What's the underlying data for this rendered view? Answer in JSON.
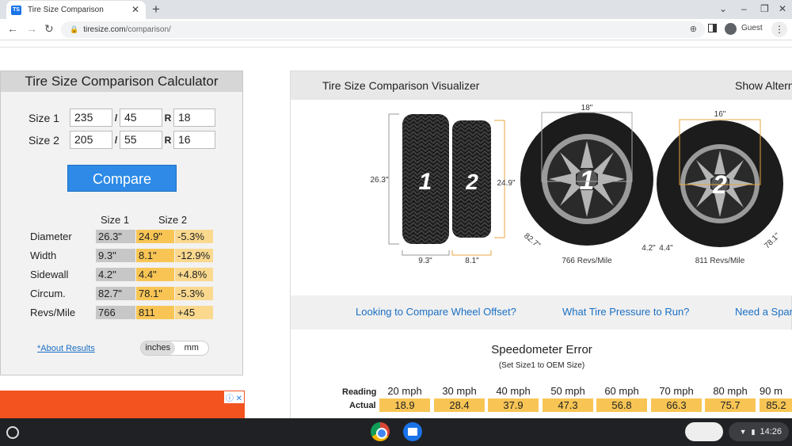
{
  "browser": {
    "tab_title": "Tire Size Comparison",
    "favicon_text": "TS",
    "url_domain": "tiresize.com",
    "url_path": "/comparison/",
    "profile_label": "Guest"
  },
  "calculator": {
    "title": "Tire Size Comparison Calculator",
    "size1": {
      "label": "Size 1",
      "width": "235",
      "aspect": "45",
      "rim": "18"
    },
    "size2": {
      "label": "Size 2",
      "width": "205",
      "aspect": "55",
      "rim": "16"
    },
    "slash": "/",
    "r_label": "R",
    "compare_label": "Compare",
    "col_size1": "Size 1",
    "col_size2": "Size 2",
    "results": [
      {
        "label": "Diameter",
        "s1": "26.3\"",
        "s2": "24.9\"",
        "diff": "-5.3%"
      },
      {
        "label": "Width",
        "s1": "9.3\"",
        "s2": "8.1\"",
        "diff": "-12.9%"
      },
      {
        "label": "Sidewall",
        "s1": "4.2\"",
        "s2": "4.4\"",
        "diff": "+4.8%"
      },
      {
        "label": "Circum.",
        "s1": "82.7\"",
        "s2": "78.1\"",
        "diff": "-5.3%"
      },
      {
        "label": "Revs/Mile",
        "s1": "766",
        "s2": "811",
        "diff": "+45"
      }
    ],
    "about_link": "*About Results",
    "unit_inches": "inches",
    "unit_mm": "mm"
  },
  "ad": {
    "close_glyphs": "ⓘ ✕"
  },
  "visualizer": {
    "title": "Tire Size Comparison Visualizer",
    "show_alt": "Show Altern",
    "diagram": {
      "tire1_number": "1",
      "tire2_number": "2",
      "diameter1": "26.3\"",
      "diameter2": "24.9\"",
      "width1": "9.3\"",
      "width2": "8.1\"",
      "rim1": "18\"",
      "rim2": "16\"",
      "sidewall1": "4.2\"",
      "sidewall2": "4.4\"",
      "circ1": "82.7\"",
      "circ2": "78.1\"",
      "revs1": "766 Revs/Mile",
      "revs2": "811 Revs/Mile"
    },
    "links": [
      "Looking to Compare Wheel Offset?",
      "What Tire Pressure to Run?",
      "Need a Spar"
    ]
  },
  "speedometer": {
    "title": "Speedometer Error",
    "subtitle": "(Set Size1 to OEM Size)",
    "reading_label": "Reading",
    "actual_label": "Actual",
    "readings": [
      "20 mph",
      "30 mph",
      "40 mph",
      "50 mph",
      "60 mph",
      "70 mph",
      "80 mph",
      "90 m"
    ],
    "actuals": [
      "18.9",
      "28.4",
      "37.9",
      "47.3",
      "56.8",
      "66.3",
      "75.7",
      "85.2"
    ]
  },
  "system": {
    "time": "14:26"
  },
  "colors": {
    "accent": "#2e8ae6",
    "size2_cell": "#f8c555",
    "diff_cell": "#fad98f",
    "size1_cell": "#c7c7c7"
  }
}
